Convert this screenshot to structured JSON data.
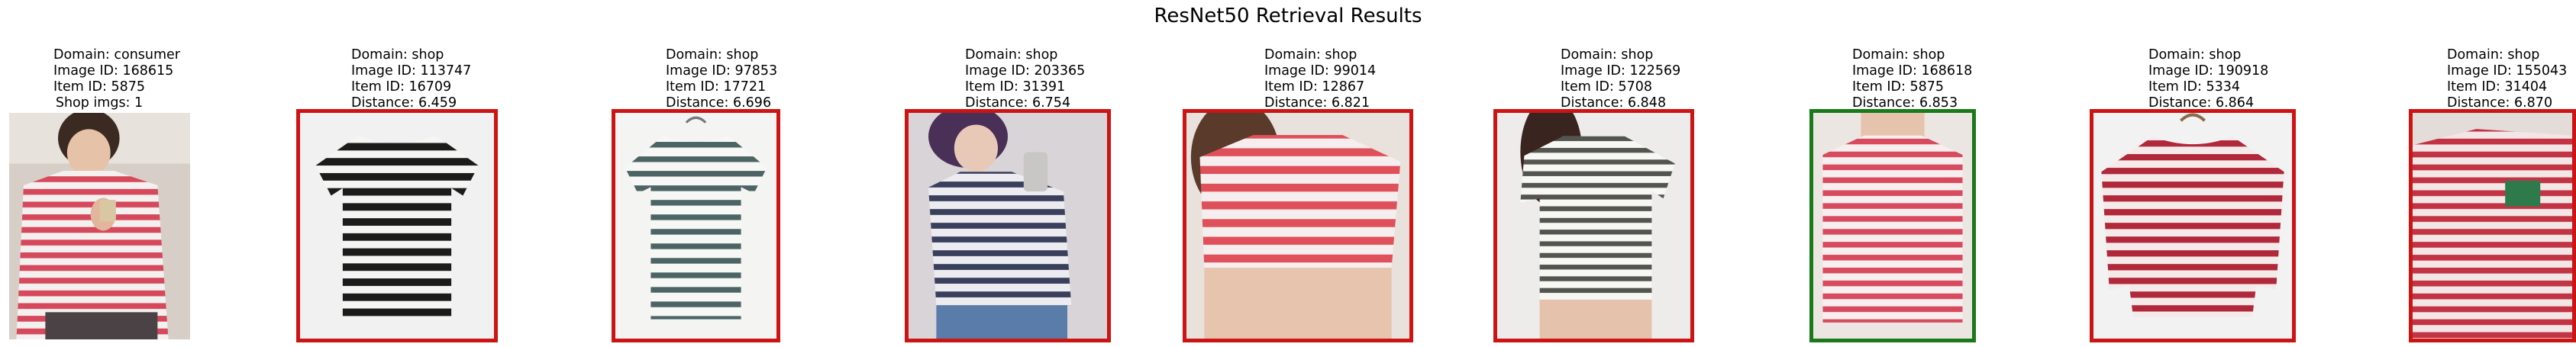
{
  "title": "ResNet50 Retrieval Results",
  "query": {
    "domain_line": "Domain: consumer",
    "image_id_line": "Image ID: 168615",
    "item_id_line": "Item ID: 5875",
    "extra_line": "Shop imgs: 1",
    "photo": "consumer-photo-red-white-striped-shirt"
  },
  "colors": {
    "correct_match_border": "#1a7a1a",
    "wrong_match_border": "#cc1414"
  },
  "results": [
    {
      "domain_line": "Domain: shop",
      "image_id_line": "Image ID: 113747",
      "item_id_line": "Item ID: 16709",
      "distance_line": "Distance: 6.459",
      "correct": false,
      "photo": "black-white-striped-tshirt"
    },
    {
      "domain_line": "Domain: shop",
      "image_id_line": "Image ID: 97853",
      "item_id_line": "Item ID: 17721",
      "distance_line": "Distance: 6.696",
      "correct": false,
      "photo": "teal-white-striped-tshirt-on-hanger"
    },
    {
      "domain_line": "Domain: shop",
      "image_id_line": "Image ID: 203365",
      "item_id_line": "Item ID: 31391",
      "distance_line": "Distance: 6.754",
      "correct": false,
      "photo": "navy-white-striped-shirt-worn"
    },
    {
      "domain_line": "Domain: shop",
      "image_id_line": "Image ID: 99014",
      "item_id_line": "Item ID: 12867",
      "distance_line": "Distance: 6.821",
      "correct": false,
      "photo": "red-white-striped-crop-top-worn"
    },
    {
      "domain_line": "Domain: shop",
      "image_id_line": "Image ID: 122569",
      "item_id_line": "Item ID: 5708",
      "distance_line": "Distance: 6.848",
      "correct": false,
      "photo": "grey-white-striped-tshirt-worn"
    },
    {
      "domain_line": "Domain: shop",
      "image_id_line": "Image ID: 168618",
      "item_id_line": "Item ID: 5875",
      "distance_line": "Distance: 6.853",
      "correct": true,
      "photo": "red-white-striped-shirt-worn"
    },
    {
      "domain_line": "Domain: shop",
      "image_id_line": "Image ID: 190918",
      "item_id_line": "Item ID: 5334",
      "distance_line": "Distance: 6.864",
      "correct": false,
      "photo": "red-white-striped-longsleeve-on-hanger"
    },
    {
      "domain_line": "Domain: shop",
      "image_id_line": "Image ID: 155043",
      "item_id_line": "Item ID: 31404",
      "distance_line": "Distance: 6.870",
      "correct": false,
      "photo": "red-white-striped-shirt-with-pocket-worn"
    }
  ]
}
